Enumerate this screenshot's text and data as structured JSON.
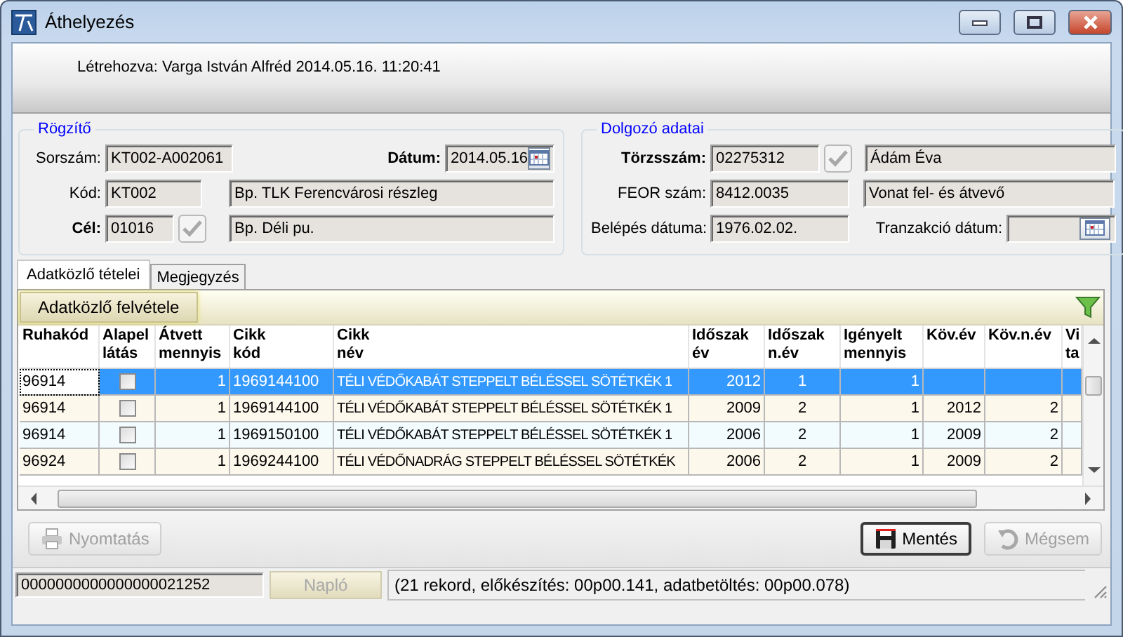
{
  "window": {
    "title": "Áthelyezés"
  },
  "created_info": "Létrehozva: Varga István Alfréd 2014.05.16. 11:20:41",
  "recorder": {
    "legend": "Rögzítő",
    "sorszam": {
      "label": "Sorszám:",
      "value": "KT002-A002061"
    },
    "datum": {
      "label": "Dátum:",
      "value": "2014.05.16"
    },
    "kod": {
      "label": "Kód:",
      "value": "KT002",
      "name": "Bp. TLK Ferencvárosi részleg"
    },
    "cel": {
      "label": "Cél:",
      "value": "01016",
      "name": "Bp. Déli pu."
    }
  },
  "employee": {
    "legend": "Dolgozó adatai",
    "torzsszam": {
      "label": "Törzsszám:",
      "value": "02275312",
      "name": "Ádám Éva"
    },
    "feor": {
      "label": "FEOR szám:",
      "value": "8412.0035",
      "name": "Vonat fel- és átvevő"
    },
    "belepes": {
      "label": "Belépés dátuma:",
      "value": "1976.02.02."
    },
    "tranzakcio": {
      "label": "Tranzakció dátum:"
    }
  },
  "tabs": [
    {
      "label": "Adatközlő tételei",
      "selected": true
    },
    {
      "label": "Megjegyzés",
      "selected": false
    }
  ],
  "toolbar": {
    "add_button": "Adatközlő felvétele"
  },
  "table": {
    "columns": [
      {
        "lines": [
          "Ruhakód"
        ],
        "kind": "text"
      },
      {
        "lines": [
          "Alapel",
          "látás"
        ],
        "kind": "check"
      },
      {
        "lines": [
          "Átvett",
          "mennyis"
        ],
        "kind": "number"
      },
      {
        "lines": [
          "Cikk",
          "kód"
        ],
        "kind": "text"
      },
      {
        "lines": [
          "Cikk",
          "név"
        ],
        "kind": "text"
      },
      {
        "lines": [
          "Időszak",
          "év"
        ],
        "kind": "number"
      },
      {
        "lines": [
          "Időszak",
          "n.év"
        ],
        "kind": "center"
      },
      {
        "lines": [
          "Igényelt",
          "mennyis"
        ],
        "kind": "number"
      },
      {
        "lines": [
          "Köv.év"
        ],
        "kind": "number"
      },
      {
        "lines": [
          "Köv.n.év"
        ],
        "kind": "number"
      },
      {
        "lines": [
          "Vi",
          "ta"
        ],
        "kind": "text"
      }
    ],
    "rows": [
      {
        "selected": true,
        "cells": [
          "96914",
          false,
          "1",
          "1969144100",
          "TÉLI VÉDŐKABÁT STEPPELT BÉLÉSSEL SÖTÉTKÉK 1",
          "2012",
          "1",
          "1",
          null,
          null,
          null
        ]
      },
      {
        "selected": false,
        "cells": [
          "96914",
          false,
          "1",
          "1969144100",
          "TÉLI VÉDŐKABÁT STEPPELT BÉLÉSSEL SÖTÉTKÉK 1",
          "2009",
          "2",
          "1",
          "2012",
          "2",
          null
        ]
      },
      {
        "selected": false,
        "cells": [
          "96914",
          false,
          "1",
          "1969150100",
          "TÉLI VÉDŐKABÁT STEPPELT BÉLÉSSEL SÖTÉTKÉK 1",
          "2006",
          "2",
          "1",
          "2009",
          "2",
          null
        ]
      },
      {
        "selected": false,
        "cells": [
          "96924",
          false,
          "1",
          "1969244100",
          "TÉLI VÉDŐNADRÁG STEPPELT BÉLÉSSEL SÖTÉTKÉK",
          "2006",
          "2",
          "1",
          "2009",
          "2",
          null
        ]
      }
    ]
  },
  "buttons": [
    {
      "label": "Nyomtatás",
      "kind": "print",
      "disabled": true
    },
    {
      "label": "Mentés",
      "kind": "save",
      "disabled": false
    },
    {
      "label": "Mégsem",
      "kind": "cancel",
      "disabled": true
    }
  ],
  "status_bar": {
    "record_id": "0000000000000000021252",
    "log_button": {
      "label": "Napló",
      "disabled": true
    },
    "message": "(21 rekord, előkészítés: 00p00.141, adatbetöltés: 00p00.078)"
  }
}
